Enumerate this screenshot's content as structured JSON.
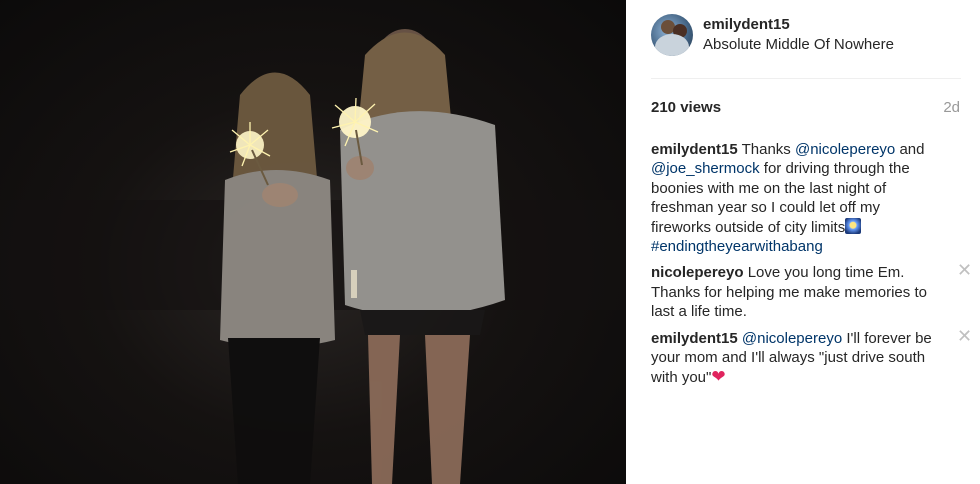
{
  "post": {
    "username": "emilydent15",
    "location": "Absolute Middle Of Nowhere",
    "views": "210 views",
    "age": "2d"
  },
  "comments": [
    {
      "user": "emilydent15",
      "parts": [
        {
          "t": "text",
          "v": " Thanks "
        },
        {
          "t": "mention",
          "v": "@nicolepereyo"
        },
        {
          "t": "text",
          "v": " and "
        },
        {
          "t": "mention",
          "v": "@joe_shermock"
        },
        {
          "t": "text",
          "v": " for driving through the boonies with me on the last night of freshman year so I could let off my fireworks outside of city limits"
        },
        {
          "t": "emoji",
          "v": "fireworks-emoji"
        },
        {
          "t": "text",
          "v": " "
        },
        {
          "t": "mention",
          "v": "#endingtheyearwithabang"
        }
      ],
      "closable": false
    },
    {
      "user": "nicolepereyo",
      "parts": [
        {
          "t": "text",
          "v": " Love you long time Em. Thanks for helping me make memories to last a life time."
        }
      ],
      "closable": true
    },
    {
      "user": "emilydent15",
      "parts": [
        {
          "t": "text",
          "v": " "
        },
        {
          "t": "mention",
          "v": "@nicolepereyo"
        },
        {
          "t": "text",
          "v": " I'll forever be your mom and I'll always \"just drive south with you\""
        },
        {
          "t": "emoji",
          "v": "red-heart-emoji"
        }
      ],
      "closable": true
    }
  ],
  "close_glyph": "✕",
  "icons": {
    "close": "close-icon",
    "avatar": "avatar"
  },
  "colors": {
    "mention": "#003569",
    "muted": "#999999",
    "divider": "#efefef"
  }
}
